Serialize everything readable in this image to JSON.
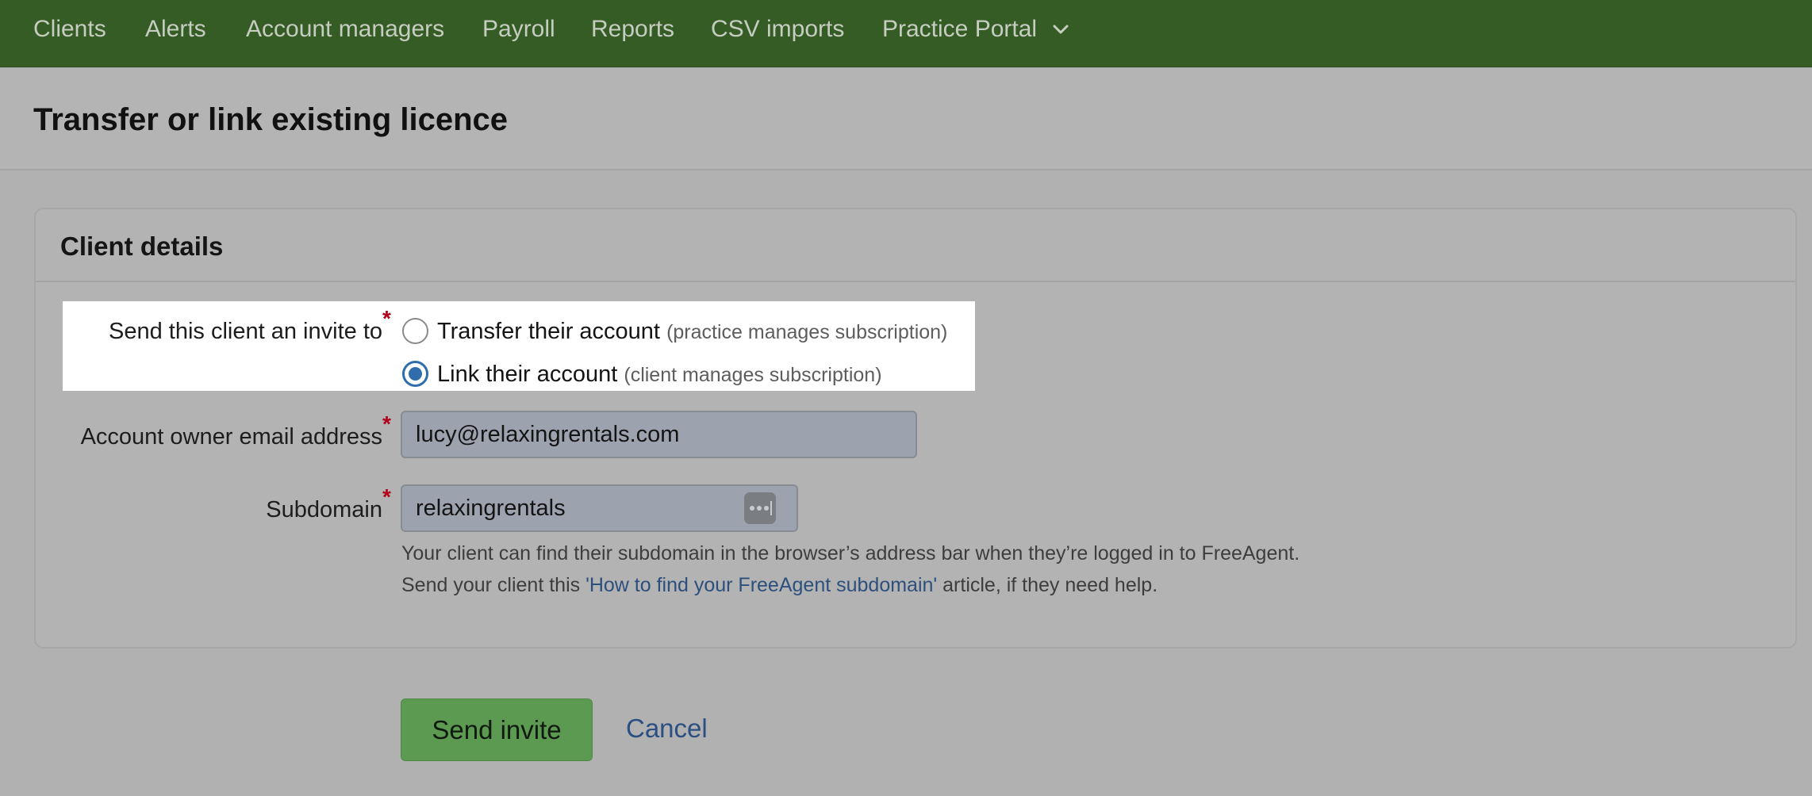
{
  "nav": {
    "items": [
      "Clients",
      "Alerts",
      "Account managers",
      "Payroll",
      "Reports",
      "CSV imports",
      "Practice Portal"
    ]
  },
  "page": {
    "title": "Transfer or link existing licence"
  },
  "card": {
    "title": "Client details"
  },
  "form": {
    "invite": {
      "label": "Send this client an invite to",
      "required": "*",
      "options": [
        {
          "label": "Transfer their account",
          "note": "(practice manages subscription)",
          "selected": false
        },
        {
          "label": "Link their account",
          "note": "(client manages subscription)",
          "selected": true
        }
      ]
    },
    "email": {
      "label": "Account owner email address",
      "required": "*",
      "value": "lucy@relaxingrentals.com"
    },
    "subdomain": {
      "label": "Subdomain",
      "required": "*",
      "value": "relaxingrentals",
      "help_line1": "Your client can find their subdomain in the browser’s address bar when they’re logged in to FreeAgent.",
      "help_pre": "Send your client this ",
      "help_link": "'How to find your FreeAgent subdomain'",
      "help_post": " article, if they need help."
    }
  },
  "actions": {
    "send_label": "Send invite",
    "cancel_label": "Cancel"
  },
  "icons": {
    "dropdown": "chevron-down-icon",
    "password_manager": "password-manager-icon"
  },
  "colors": {
    "nav_bg": "#365c26",
    "primary_button": "#5d9a51",
    "link": "#2d4f7d",
    "required": "#b3001a"
  }
}
